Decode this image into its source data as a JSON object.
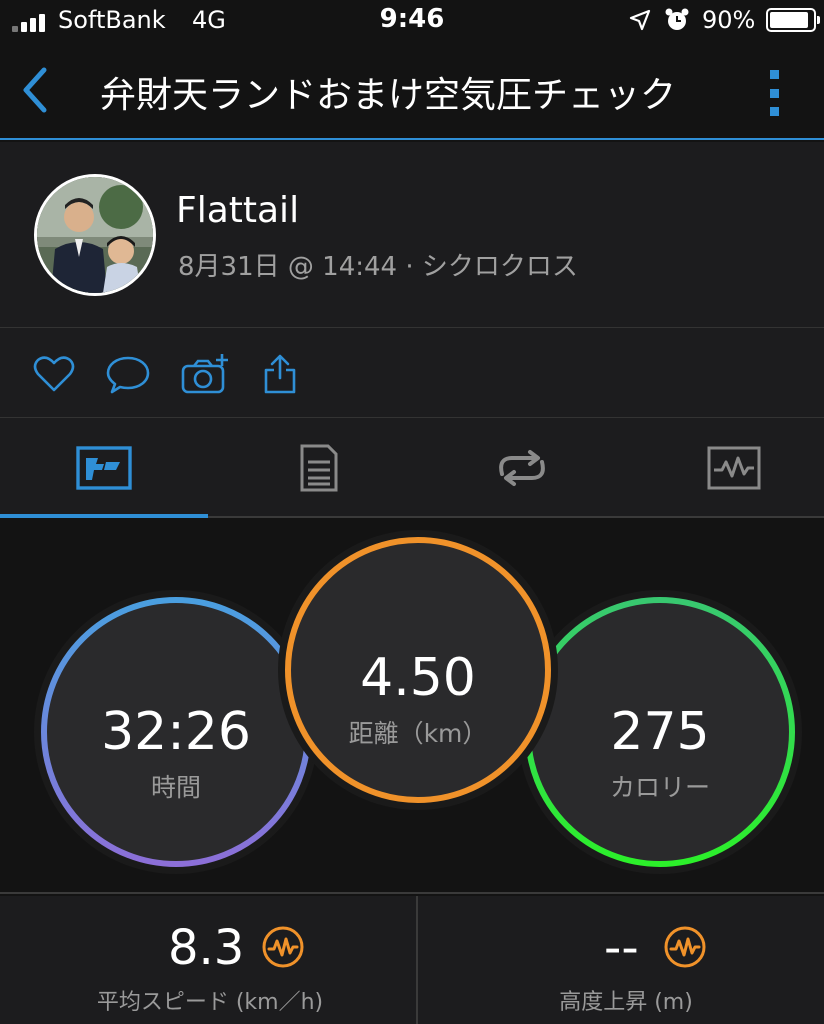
{
  "status_bar": {
    "carrier": "SoftBank",
    "network": "4G",
    "time": "9:46",
    "battery": "90%"
  },
  "header": {
    "title": "弁財天ランドおまけ空気圧チェック"
  },
  "profile": {
    "name": "Flattail",
    "meta": "8月31日 @ 14:44 · シクロクロス"
  },
  "actions": [
    "like-icon",
    "comment-icon",
    "add-photo-icon",
    "share-icon"
  ],
  "tabs": [
    "stats-tab",
    "details-tab",
    "laps-tab",
    "charts-tab"
  ],
  "stats": {
    "time": {
      "value": "32:26",
      "label": "時間"
    },
    "distance": {
      "value": "4.50",
      "label": "距離（km）"
    },
    "calories": {
      "value": "275",
      "label": "カロリー"
    }
  },
  "metrics": {
    "avg_speed": {
      "value": "8.3",
      "label": "平均スピード (km／h)"
    },
    "ascent": {
      "value": "--",
      "label": "高度上昇 (m)"
    }
  },
  "colors": {
    "accent": "#2f8fd6",
    "orange": "#f0922a",
    "green": "#3ddc56",
    "blue": "#4a9fe0",
    "purple": "#8c6fd8"
  }
}
